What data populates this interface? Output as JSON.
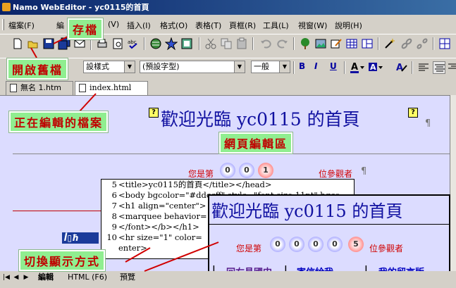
{
  "window": {
    "title": "Namo WebEditor - yc0115的首頁"
  },
  "menubar": {
    "items": [
      {
        "label": "檔案(F)",
        "key": "file"
      },
      {
        "label": "編",
        "key": "edit"
      },
      {
        "label": "(V)",
        "key": "view"
      },
      {
        "label": "插入(I)",
        "key": "insert"
      },
      {
        "label": "格式(O)",
        "key": "format"
      },
      {
        "label": "表格(T)",
        "key": "table"
      },
      {
        "label": "頁框(R)",
        "key": "frame"
      },
      {
        "label": "工具(L)",
        "key": "tools"
      },
      {
        "label": "視窗(W)",
        "key": "window"
      },
      {
        "label": "說明(H)",
        "key": "help"
      }
    ]
  },
  "toolbar2": {
    "style_combo": "設樣式",
    "font_combo": "(預設字型)",
    "size_combo": "一般",
    "bold": "B",
    "italic": "I",
    "underline": "U"
  },
  "doc_tabs": [
    {
      "label": "無名 1.htm"
    },
    {
      "label": "index.html"
    }
  ],
  "editor": {
    "heading": "歡迎光臨 yc0115 的首頁",
    "pilcrow": "¶",
    "visitor_prefix": "您是第",
    "visitor_suffix": "位參觀者",
    "counter_digits": [
      "0",
      "0",
      "1"
    ]
  },
  "code_view": {
    "lines": [
      {
        "num": "5",
        "text": "<title>yc0115的首頁</title></head>"
      },
      {
        "num": "6",
        "text": "<body bgcolor=\"#ddccff\" style=\"font-size:11pt\" bgco"
      },
      {
        "num": "7",
        "text": "<h1 align=\"center\">"
      },
      {
        "num": "8",
        "text": "<marquee behavior="
      },
      {
        "num": "9",
        "text": "</font></b></h1>"
      },
      {
        "num": "10",
        "text": "<hr size=\"1\" color="
      },
      {
        "num": "",
        "text": "enter>"
      }
    ]
  },
  "preview": {
    "title": "歡迎光臨 yc0115 的首頁",
    "visitor_prefix": "您是第",
    "visitor_suffix": "位參觀者",
    "counter_digits": [
      "0",
      "0",
      "0",
      "0",
      "5"
    ],
    "links": [
      {
        "label": "回右昌國中"
      },
      {
        "label": "寄信給我"
      },
      {
        "label": "我的留言版"
      }
    ],
    "separator": "|"
  },
  "bottom_tabs": {
    "edit": "編輯",
    "html": "HTML (F6)",
    "preview": "預覽"
  },
  "callouts": {
    "save": "存檔",
    "open_old": "開啟舊檔",
    "editing_file": "正在編輯的檔案",
    "page_edit_area": "網頁編輯區",
    "switch_view": "切換顯示方式"
  },
  "colors": {
    "callout_bg": "#90ee90",
    "callout_text": "#c00000",
    "editor_bg": "#dcdcff",
    "heading": "#1010a0",
    "title_bar": "#0a246a"
  }
}
